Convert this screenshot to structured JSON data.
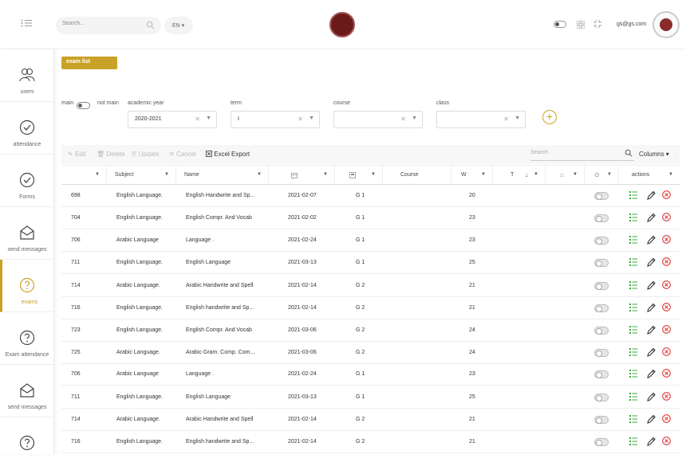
{
  "header": {
    "search_placeholder": "Search...",
    "language": "EN",
    "user_email": "gs@gs.com"
  },
  "sidebar": {
    "items": [
      {
        "label": "users",
        "icon": "users-icon"
      },
      {
        "label": "attendance",
        "icon": "check-circle-icon"
      },
      {
        "label": "Forms",
        "icon": "check-circle-icon"
      },
      {
        "label": "send messages",
        "icon": "envelope-icon"
      },
      {
        "label": "exams",
        "icon": "question-circle-icon",
        "active": true
      },
      {
        "label": "Exam attendance",
        "icon": "question-circle-icon"
      },
      {
        "label": "send messages",
        "icon": "envelope-icon"
      },
      {
        "label": "",
        "icon": "question-circle-icon"
      }
    ]
  },
  "breadcrumb": "exam list",
  "filters": {
    "main_label": "main",
    "not_main_label": "not main",
    "academic_year_label": "academic year",
    "academic_year_value": "2020-2021",
    "term_label": "term",
    "term_value": "I",
    "course_label": "course",
    "course_value": "",
    "class_label": "class",
    "class_value": ""
  },
  "toolbar": {
    "edit": "Edit",
    "delete": "Delete",
    "update": "Update",
    "cancel": "Cancel",
    "excel_export": "Excel Export",
    "search_placeholder": "Search",
    "columns": "Columns"
  },
  "table": {
    "columns": [
      "",
      "Subject",
      "Name",
      "",
      "",
      "Course",
      "W",
      "T",
      "",
      "",
      "actions"
    ],
    "rows": [
      {
        "id": "698",
        "subject": "English Language.",
        "name": "English Handwrite and Sp...",
        "date": "2021-02-07",
        "grade": "G 1",
        "w": "20"
      },
      {
        "id": "704",
        "subject": "English Language.",
        "name": "English Compr. And Vocab",
        "date": "2021-02-02",
        "grade": "G 1",
        "w": "23"
      },
      {
        "id": "706",
        "subject": "Arabic Language",
        "name": "Language .",
        "date": "2021-02-24",
        "grade": "G 1",
        "w": "23"
      },
      {
        "id": "711",
        "subject": "English Language.",
        "name": "English Language",
        "date": "2021-03-13",
        "grade": "G 1",
        "w": "25"
      },
      {
        "id": "714",
        "subject": "Arabic Language.",
        "name": "Arabic Handwrite and Spell",
        "date": "2021-02-14",
        "grade": "G 2",
        "w": "21"
      },
      {
        "id": "716",
        "subject": "English Language.",
        "name": "English handwrite and Sp...",
        "date": "2021-02-14",
        "grade": "G 2",
        "w": "21"
      },
      {
        "id": "723",
        "subject": "English Language.",
        "name": "English Compr. And Vocab",
        "date": "2021-03-06",
        "grade": "G 2",
        "w": "24"
      },
      {
        "id": "725",
        "subject": "Arabic Language.",
        "name": "Arabic Gram. Comp. Com...",
        "date": "2021-03-06",
        "grade": "G 2",
        "w": "24"
      },
      {
        "id": "706",
        "subject": "Arabic Language",
        "name": "Language .",
        "date": "2021-02-24",
        "grade": "G 1",
        "w": "23"
      },
      {
        "id": "711",
        "subject": "English Language.",
        "name": "English Language",
        "date": "2021-03-13",
        "grade": "G 1",
        "w": "25"
      },
      {
        "id": "714",
        "subject": "Arabic Language.",
        "name": "Arabic Handwrite and Spell",
        "date": "2021-02-14",
        "grade": "G 2",
        "w": "21"
      },
      {
        "id": "716",
        "subject": "English Language.",
        "name": "English handwrite and Sp...",
        "date": "2021-02-14",
        "grade": "G 2",
        "w": "21"
      }
    ]
  },
  "colors": {
    "accent": "#c9a227",
    "list_icon": "#3aa83a",
    "delete_icon": "#e03b3b",
    "logo": "#6b1a1a"
  }
}
